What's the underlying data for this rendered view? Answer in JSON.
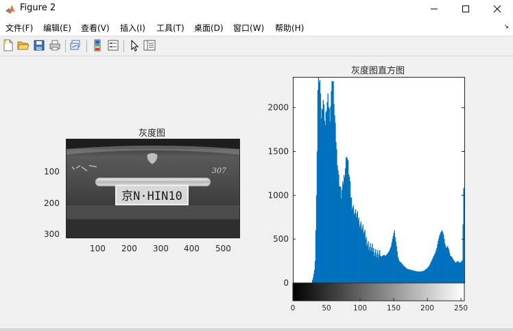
{
  "window": {
    "title": "Figure 2"
  },
  "menu": {
    "items": [
      {
        "id": "file",
        "label": "文件(F)"
      },
      {
        "id": "edit",
        "label": "编辑(E)"
      },
      {
        "id": "view",
        "label": "查看(V)"
      },
      {
        "id": "insert",
        "label": "插入(I)"
      },
      {
        "id": "tools",
        "label": "工具(T)"
      },
      {
        "id": "desktop",
        "label": "桌面(D)"
      },
      {
        "id": "window",
        "label": "窗口(W)"
      },
      {
        "id": "help",
        "label": "帮助(H)"
      }
    ]
  },
  "toolbar": {
    "buttons": [
      "new-figure-icon",
      "open-file-icon",
      "save-icon",
      "print-icon",
      "link-plot-icon",
      "insert-colorbar-icon",
      "insert-legend-icon",
      "edit-plot-icon",
      "property-inspector-icon"
    ]
  },
  "image_axes": {
    "title": "灰度图",
    "xticks": [
      "100",
      "200",
      "300",
      "400",
      "500"
    ],
    "yticks": [
      "100",
      "200",
      "300"
    ],
    "plate_text": "京N·HIN10",
    "badge_text": "307"
  },
  "chart_data": {
    "type": "bar",
    "title": "灰度图直方图",
    "xlabel": "",
    "ylabel": "",
    "xlim": [
      0,
      255
    ],
    "ylim": [
      0,
      2350
    ],
    "xticks": [
      0,
      50,
      100,
      150,
      200,
      250
    ],
    "yticks": [
      0,
      500,
      1000,
      1500,
      2000
    ],
    "bar_color": "#0072bd",
    "colorbar": "gray",
    "points": [
      [
        0,
        0
      ],
      [
        25,
        0
      ],
      [
        28,
        5
      ],
      [
        30,
        60
      ],
      [
        32,
        150
      ],
      [
        33,
        250
      ],
      [
        34,
        600
      ],
      [
        35,
        1000
      ],
      [
        36,
        1500
      ],
      [
        37,
        2200
      ],
      [
        38,
        2350
      ],
      [
        40,
        2300
      ],
      [
        42,
        1900
      ],
      [
        45,
        2100
      ],
      [
        48,
        1800
      ],
      [
        50,
        2000
      ],
      [
        52,
        2100
      ],
      [
        55,
        1900
      ],
      [
        57,
        2150
      ],
      [
        58,
        2350
      ],
      [
        60,
        2250
      ],
      [
        62,
        1900
      ],
      [
        65,
        1500
      ],
      [
        68,
        1200
      ],
      [
        70,
        1100
      ],
      [
        72,
        1000
      ],
      [
        75,
        1150
      ],
      [
        78,
        1320
      ],
      [
        80,
        1480
      ],
      [
        82,
        1350
      ],
      [
        84,
        1200
      ],
      [
        86,
        1000
      ],
      [
        88,
        900
      ],
      [
        90,
        850
      ],
      [
        92,
        800
      ],
      [
        95,
        780
      ],
      [
        98,
        720
      ],
      [
        100,
        680
      ],
      [
        102,
        650
      ],
      [
        105,
        600
      ],
      [
        108,
        520
      ],
      [
        110,
        480
      ],
      [
        113,
        420
      ],
      [
        116,
        400
      ],
      [
        119,
        380
      ],
      [
        122,
        360
      ],
      [
        125,
        330
      ],
      [
        128,
        320
      ],
      [
        132,
        300
      ],
      [
        135,
        320
      ],
      [
        138,
        310
      ],
      [
        140,
        330
      ],
      [
        143,
        360
      ],
      [
        146,
        420
      ],
      [
        148,
        500
      ],
      [
        150,
        570
      ],
      [
        151,
        600
      ],
      [
        152,
        520
      ],
      [
        154,
        420
      ],
      [
        156,
        300
      ],
      [
        158,
        250
      ],
      [
        161,
        230
      ],
      [
        164,
        200
      ],
      [
        167,
        180
      ],
      [
        170,
        160
      ],
      [
        175,
        150
      ],
      [
        180,
        140
      ],
      [
        185,
        130
      ],
      [
        190,
        130
      ],
      [
        195,
        140
      ],
      [
        200,
        170
      ],
      [
        203,
        200
      ],
      [
        206,
        250
      ],
      [
        209,
        300
      ],
      [
        212,
        350
      ],
      [
        214,
        400
      ],
      [
        216,
        480
      ],
      [
        218,
        540
      ],
      [
        220,
        580
      ],
      [
        222,
        600
      ],
      [
        224,
        550
      ],
      [
        226,
        450
      ],
      [
        228,
        400
      ],
      [
        230,
        420
      ],
      [
        232,
        380
      ],
      [
        234,
        310
      ],
      [
        236,
        300
      ],
      [
        239,
        260
      ],
      [
        242,
        230
      ],
      [
        245,
        250
      ],
      [
        248,
        230
      ],
      [
        250,
        240
      ],
      [
        252,
        260
      ],
      [
        254,
        1080
      ],
      [
        255,
        1080
      ]
    ]
  }
}
